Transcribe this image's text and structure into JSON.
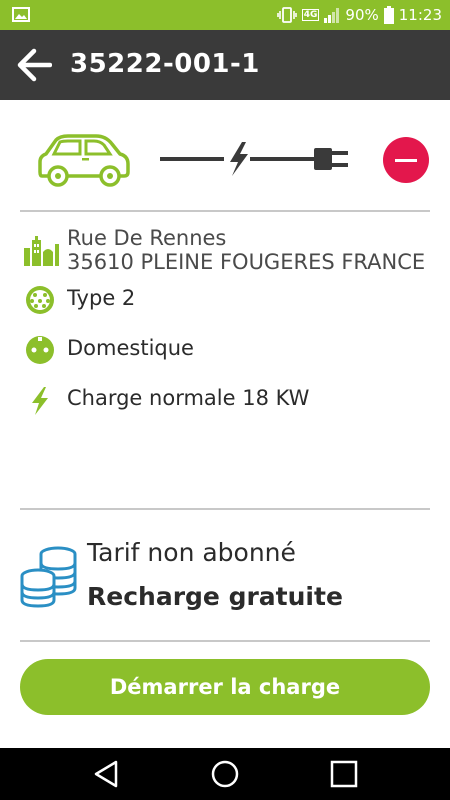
{
  "status_bar": {
    "battery": "90%",
    "time": "11:23",
    "network": "4G",
    "image_icon": "image-icon",
    "vibrate_icon": "vibrate-icon",
    "signal_icon": "signal-icon",
    "battery_icon": "battery-icon"
  },
  "header": {
    "title": "35222-001-1",
    "back_icon": "arrow-left-icon",
    "bg_color": "#3a3a3a"
  },
  "hero": {
    "car_icon": "car-icon",
    "cable_icon": "charging-cable-icon",
    "remove_icon": "minus-circle-icon",
    "accent_color": "#8cbf2b",
    "remove_color": "#e3174c"
  },
  "station": {
    "address_line1": "Rue De Rennes",
    "address_line2": "35610 PLEINE FOUGERES FRANCE",
    "connector": "Type 2",
    "socket": "Domestique",
    "power": "Charge normale 18 KW",
    "icons": [
      "city-icon",
      "type2-connector-icon",
      "domestic-socket-icon",
      "lightning-icon"
    ]
  },
  "tarif": {
    "label": "Tarif non abonné",
    "value": "Recharge gratuite",
    "icon": "coins-icon"
  },
  "actions": {
    "start_label": "Démarrer la charge"
  },
  "nav": {
    "back_icon": "nav-back-icon",
    "home_icon": "nav-home-icon",
    "recents_icon": "nav-recents-icon"
  }
}
